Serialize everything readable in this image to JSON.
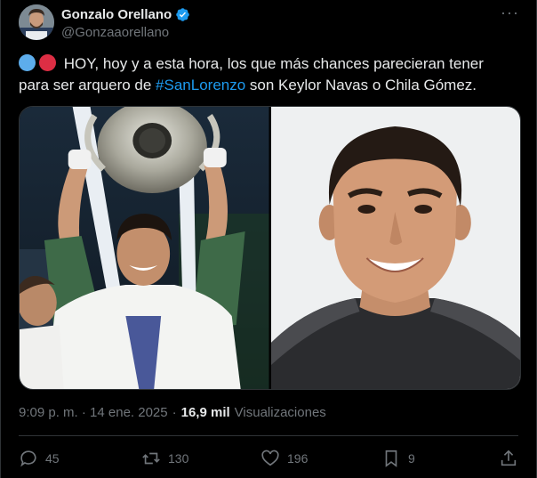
{
  "author": {
    "display_name": "Gonzalo Orellano",
    "handle": "@Gonzaaorellano",
    "verified": true
  },
  "tweet": {
    "text_before": "HOY, hoy y a esta hora, los que más chances parecieran tener para ser arquero de ",
    "hashtag": "#SanLorenzo",
    "text_after": " son Keylor Navas o Chila Gómez.",
    "emojis": [
      "blue-circle",
      "red-circle"
    ],
    "media": [
      {
        "alt": "Keylor Navas lifting the Champions League trophy"
      },
      {
        "alt": "Chila Gómez portrait"
      }
    ]
  },
  "meta": {
    "timestamp": "9:09 p. m. · 14 ene. 2025",
    "separator": "·",
    "views_count": "16,9 mil",
    "views_label": "Visualizaciones"
  },
  "actions": {
    "replies": "45",
    "reposts": "130",
    "likes": "196",
    "bookmarks": "9"
  },
  "colors": {
    "background": "#000000",
    "text": "#e7e9ea",
    "secondary": "#71767b",
    "accent": "#1d9bf0",
    "divider": "#2f3336"
  },
  "icons": [
    "verified-badge-icon",
    "more-icon",
    "reply-icon",
    "repost-icon",
    "like-icon",
    "bookmark-icon",
    "share-icon"
  ]
}
